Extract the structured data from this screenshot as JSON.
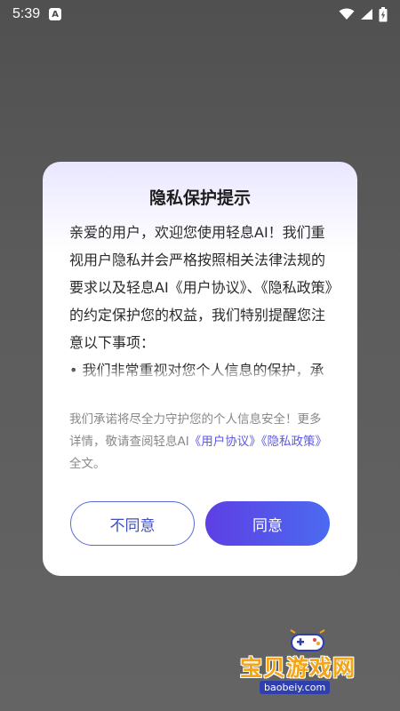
{
  "status_bar": {
    "time": "5:39",
    "app_icon_letter": "A",
    "icons": [
      "wifi-icon",
      "signal-icon",
      "battery-charging-icon"
    ]
  },
  "dialog": {
    "title": "隐私保护提示",
    "body": "亲爱的用户，欢迎您使用轻息AI！我们重视用户隐私并会严格按照相关法律法规的要求以及轻息AI《用户协议》、《隐私政策》的约定保护您的权益，我们特别提醒您注意以下事项：\n• 我们非常重视对您个人信息的保护，承诺严格按照轻息AI隐私权政策保护您",
    "notice_prefix": "我们承诺将尽全力守护您的个人信息安全！更多详情，敬请查阅轻息AI",
    "user_agreement_link": "《用户协议》",
    "privacy_policy_link": "《隐私政策》",
    "notice_suffix": "全文。",
    "disagree_label": "不同意",
    "agree_label": "同意"
  },
  "watermark": {
    "title": "宝贝游戏网",
    "url": "baobeiy.com"
  },
  "colors": {
    "accent": "#5b58e8",
    "agree_gradient_start": "#5e3fe4",
    "agree_gradient_end": "#4b6af0",
    "watermark_orange": "#f2a516"
  }
}
